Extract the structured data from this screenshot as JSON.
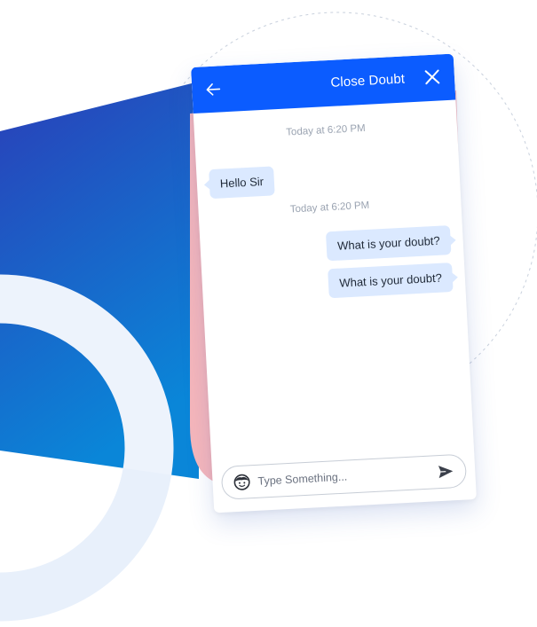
{
  "colors": {
    "header_bg": "#0b5cff",
    "bubble_bg": "#dbe9ff",
    "timestamp": "#9aa3b1",
    "accent_pink": "#f6b6bb",
    "gradient_start": "#2a3fb8",
    "gradient_end": "#0a86d8"
  },
  "header": {
    "back_icon": "arrow-left-icon",
    "title": "Close Doubt",
    "close_icon": "close-icon"
  },
  "messages": [
    {
      "type": "timestamp",
      "text": "Today at 6:20 PM"
    },
    {
      "type": "incoming",
      "text": "Hello Sir"
    },
    {
      "type": "timestamp",
      "text": "Today at 6:20 PM"
    },
    {
      "type": "outgoing",
      "text": "What is your doubt?"
    },
    {
      "type": "outgoing",
      "text": "What is your doubt?"
    }
  ],
  "composer": {
    "emoji_icon": "emoji-face-icon",
    "placeholder": "Type Something...",
    "value": "",
    "send_icon": "send-icon"
  }
}
